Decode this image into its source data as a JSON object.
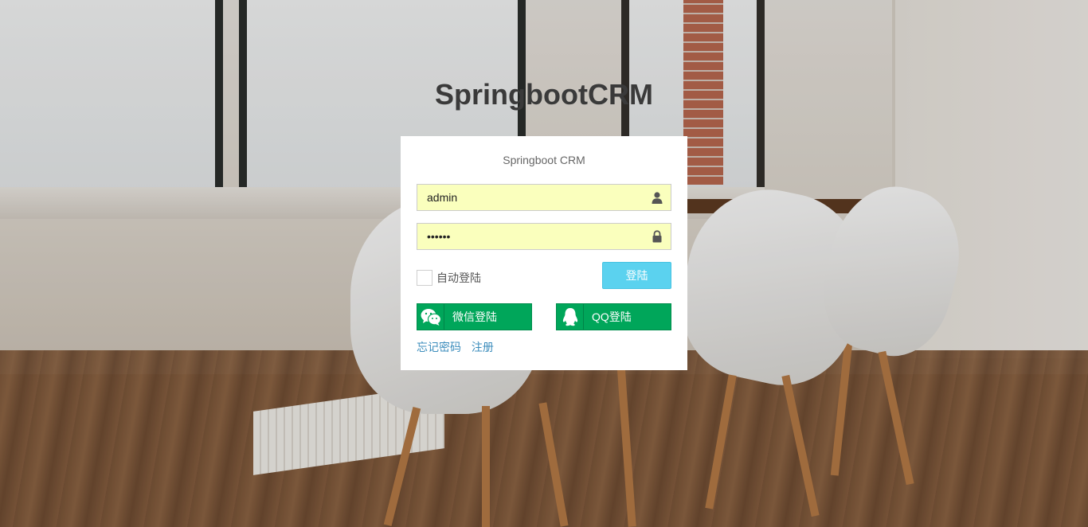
{
  "app_title": "SpringbootCRM",
  "login_box": {
    "title": "Springboot CRM",
    "username": {
      "value": "admin",
      "icon": "user-icon"
    },
    "password": {
      "value": "••••••",
      "icon": "lock-icon"
    },
    "remember_label": "自动登陆",
    "remember_checked": false,
    "login_button": "登陆",
    "wechat_button": "微信登陆",
    "qq_button": "QQ登陆",
    "forgot_link": "忘记密码",
    "register_link": "注册"
  },
  "colors": {
    "login_button": "#5bd2ef",
    "social_button": "#00a65a",
    "link": "#3c8dbc",
    "input_bg": "#faffbd"
  }
}
